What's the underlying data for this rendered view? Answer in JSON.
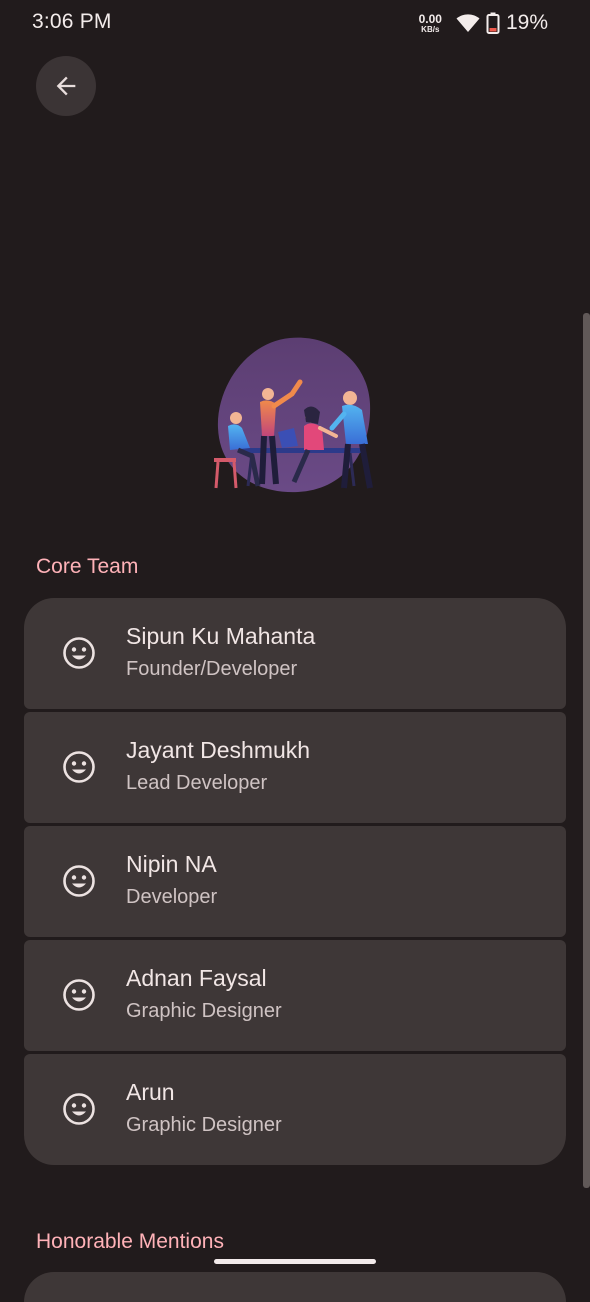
{
  "status_bar": {
    "time": "3:06 PM",
    "net_speed_value": "0.00",
    "net_speed_unit": "KB/s",
    "battery": "19%"
  },
  "colors": {
    "background": "#211b1c",
    "card": "#3e3737",
    "accent": "#ffb2b8"
  },
  "sections": {
    "core_team": "Core Team",
    "honorable_mentions": "Honorable Mentions"
  },
  "team": [
    {
      "name": "Sipun Ku Mahanta",
      "role": "Founder/Developer",
      "icon": "smile-icon"
    },
    {
      "name": "Jayant Deshmukh",
      "role": "Lead Developer",
      "icon": "smile-icon"
    },
    {
      "name": "Nipin NA",
      "role": "Developer",
      "icon": "smile-icon"
    },
    {
      "name": "Adnan Faysal",
      "role": "Graphic Designer",
      "icon": "smile-icon"
    },
    {
      "name": "Arun",
      "role": "Graphic Designer",
      "icon": "smile-icon"
    }
  ]
}
